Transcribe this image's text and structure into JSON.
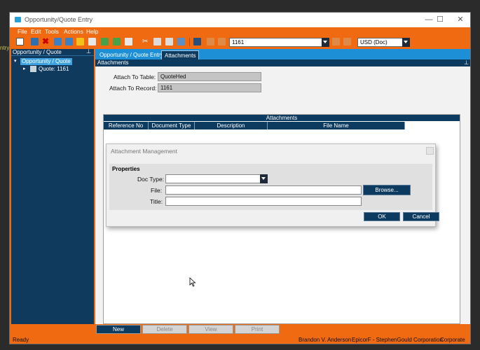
{
  "side_fragment": "ntry",
  "window": {
    "title": "Opportunity/Quote Entry",
    "controls": [
      "minimize",
      "maximize",
      "close"
    ]
  },
  "menu": [
    "File",
    "Edit",
    "Tools",
    "Actions",
    "Help"
  ],
  "toolbar": {
    "record_value": "1161",
    "currency_value": "USD (Doc)",
    "icons": [
      "new-icon",
      "save-icon",
      "delete-icon",
      "refresh-icon",
      "print-icon",
      "open-icon",
      "folder-icon",
      "brush-icon",
      "check-icon",
      "undo-icon",
      "cut-icon",
      "copy-icon",
      "paste-icon",
      "link-icon",
      "binoculars-icon",
      "first-record-icon",
      "previous-record-icon",
      "next-record-icon",
      "last-record-icon",
      "back-icon",
      "forward-icon",
      "stop-icon"
    ]
  },
  "tree": {
    "header": "Opportunity / Quote",
    "root": "Opportunity / Quote",
    "child": "Quote: 1161"
  },
  "tabs": [
    "Opportunity / Quote Entry",
    "Attachments"
  ],
  "subheader": "Attachments",
  "form": {
    "attach_to_table_label": "Attach To Table:",
    "attach_to_table_value": "QuoteHed",
    "attach_to_record_label": "Attach To Record:",
    "attach_to_record_value": "1161"
  },
  "grid": {
    "title": "Attachments",
    "columns": [
      "Reference No",
      "Document Type",
      "Description",
      "File Name"
    ]
  },
  "dialog": {
    "title": "Attachment Management",
    "group_label": "Properties",
    "doc_type_label": "Doc Type:",
    "doc_type_value": "",
    "file_label": "File:",
    "file_value": "",
    "browse_label": "Browse...",
    "title_label": "Title:",
    "title_value": "",
    "ok_label": "OK",
    "cancel_label": "Cancel"
  },
  "bottom_buttons": [
    "New",
    "Delete",
    "View",
    "Print"
  ],
  "status": {
    "left": "Ready",
    "user": "Brandon V. Anderson",
    "company": "EpicorF - StephenGould Corporation",
    "site": "Corporate"
  },
  "colors": {
    "frame_orange": "#f06a12",
    "navy": "#0d3b60",
    "tab_blue": "#1d8fd6",
    "selection_blue": "#3ea2e0"
  }
}
